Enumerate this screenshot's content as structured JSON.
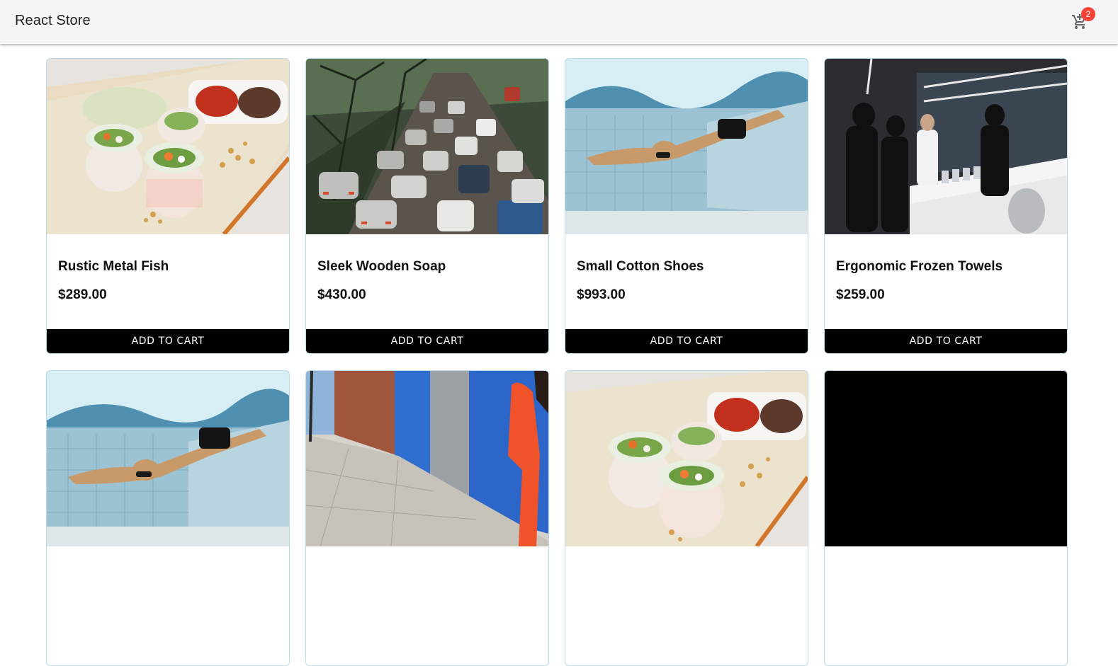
{
  "app": {
    "title": "React Store"
  },
  "cart": {
    "icon": "shopping-cart-icon",
    "count": "2",
    "badge_color": "#f44336"
  },
  "theme": {
    "button_bg": "#000000",
    "card_border": "#bfdde8",
    "appbar_bg": "#f5f5f5"
  },
  "products": [
    {
      "name": "Rustic Metal Fish",
      "price": "$289.00",
      "button": "ADD TO CART",
      "image": "food"
    },
    {
      "name": "Sleek Wooden Soap",
      "price": "$430.00",
      "button": "ADD TO CART",
      "image": "traffic"
    },
    {
      "name": "Small Cotton Shoes",
      "price": "$993.00",
      "button": "ADD TO CART",
      "image": "swimmer"
    },
    {
      "name": "Ergonomic Frozen Towels",
      "price": "$259.00",
      "button": "ADD TO CART",
      "image": "bar"
    },
    {
      "image": "swimmer"
    },
    {
      "image": "street-fashion"
    },
    {
      "image": "food"
    },
    {
      "image": "black"
    }
  ]
}
